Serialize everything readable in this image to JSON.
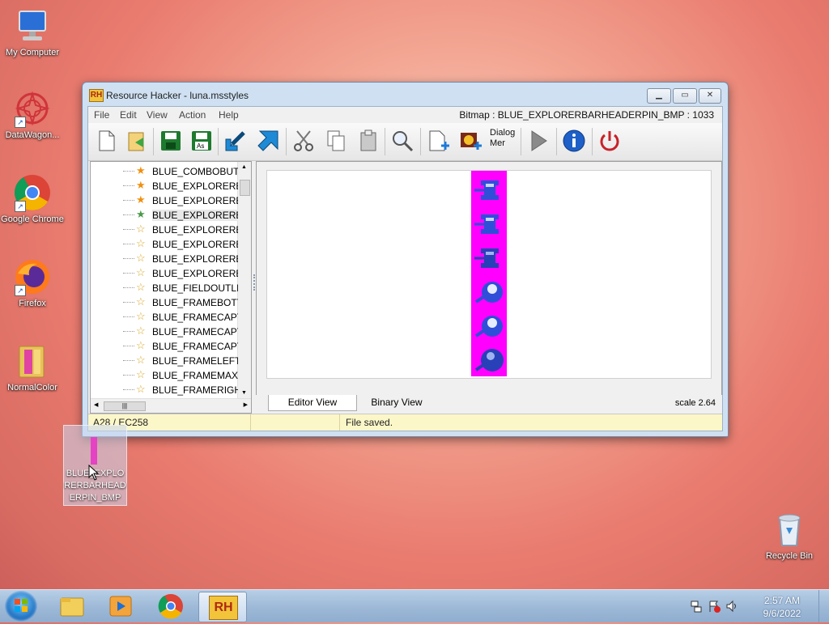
{
  "desktop": {
    "icons": [
      {
        "label": "My Computer"
      },
      {
        "label": "DataWagon..."
      },
      {
        "label": "Google Chrome"
      },
      {
        "label": "Firefox"
      },
      {
        "label": "NormalColor"
      },
      {
        "label": "Recycle Bin"
      }
    ],
    "dragged_file": {
      "label": "BLUE_EXPLORERBARHEADERPIN_BMP"
    }
  },
  "window": {
    "title": "Resource Hacker - luna.msstyles",
    "logo_text": "RH",
    "menu": [
      "File",
      "Edit",
      "View",
      "Action",
      "Help"
    ],
    "resource_info": "Bitmap : BLUE_EXPLORERBARHEADERPIN_BMP : 1033",
    "toolbar": {
      "dialog_menu_label": "Dialog Mer"
    },
    "tree": {
      "items": [
        {
          "label": "BLUE_COMBOBUTT",
          "star": "orange"
        },
        {
          "label": "BLUE_EXPLORERBA",
          "star": "orange"
        },
        {
          "label": "BLUE_EXPLORERBA",
          "star": "orange"
        },
        {
          "label": "BLUE_EXPLORERBA",
          "star": "green"
        },
        {
          "label": "BLUE_EXPLORERBA",
          "star": "outline"
        },
        {
          "label": "BLUE_EXPLORERBA",
          "star": "outline"
        },
        {
          "label": "BLUE_EXPLORERBA",
          "star": "outline"
        },
        {
          "label": "BLUE_EXPLORERBA",
          "star": "outline"
        },
        {
          "label": "BLUE_FIELDOUTLII",
          "star": "outline"
        },
        {
          "label": "BLUE_FRAMEBOTT",
          "star": "outline"
        },
        {
          "label": "BLUE_FRAMECAPT",
          "star": "outline"
        },
        {
          "label": "BLUE_FRAMECAPT",
          "star": "outline"
        },
        {
          "label": "BLUE_FRAMECAPT",
          "star": "outline"
        },
        {
          "label": "BLUE_FRAMELEFT_",
          "star": "outline"
        },
        {
          "label": "BLUE_FRAMEMAXII",
          "star": "outline"
        },
        {
          "label": "BLUE_FRAMERIGHT",
          "star": "outline"
        }
      ]
    },
    "tabs": [
      "Editor View",
      "Binary View"
    ],
    "scale": "scale 2.64",
    "status": {
      "position": "A28 / EC258",
      "message": "File saved."
    }
  },
  "taskbar": {
    "time": "2:57 AM",
    "date": "9/6/2022"
  },
  "colors": {
    "bitmap_background": "#ff00ff",
    "status_bar": "#fbf7c8",
    "pin_blue": "#2f4fd8"
  }
}
